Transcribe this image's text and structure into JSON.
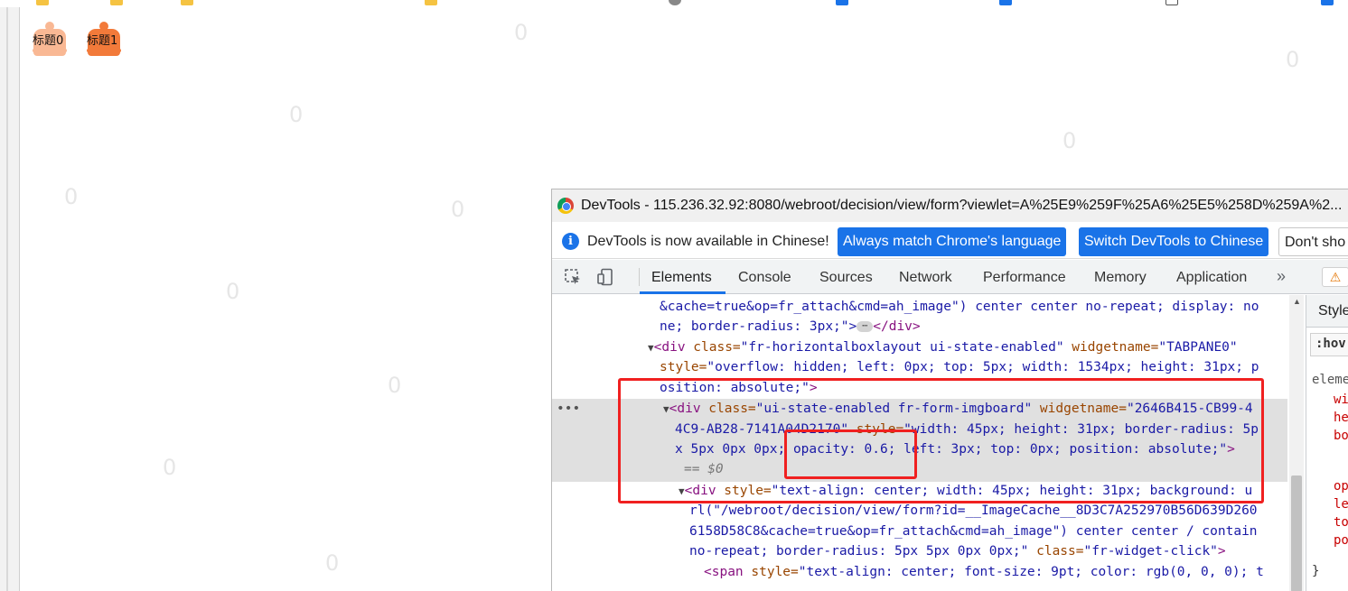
{
  "page": {
    "tabs": [
      {
        "label": "标题0",
        "color": "#f9b894"
      },
      {
        "label": "标题1",
        "color": "#f27a3a"
      }
    ],
    "watermark_char": "0"
  },
  "devtools": {
    "title": "DevTools - 115.236.32.92:8080/webroot/decision/view/form?viewlet=A%25E9%259F%25A6%25E5%258D%259A%2...",
    "info_message": "DevTools is now available in Chinese!",
    "buttons": {
      "match": "Always match Chrome's language",
      "switch": "Switch DevTools to Chinese",
      "dont_show": "Don't sho"
    },
    "panels": [
      "Elements",
      "Console",
      "Sources",
      "Network",
      "Performance",
      "Memory",
      "Application"
    ],
    "active_panel": "Elements",
    "more_tabs": "»",
    "warning": "⚠",
    "dom": {
      "l1": "&cache=true&op=fr_attach&cmd=ah_image\") center center no-repeat; display: no",
      "l2_text": "ne; border-radius: 3px;\">",
      "l2_close": "</div>",
      "ellipsis": "⋯",
      "l3_tag": "<div",
      "l3_attr": " class=",
      "l3_val": "\"fr-horizontalboxlayout ui-state-enabled\"",
      "l3_attr2": " widgetname=",
      "l3_val2": "\"TABPANE0\"",
      "l4_attr": "style=",
      "l4_val": "\"overflow: hidden; left: 0px; top: 5px; width: 1534px; height: 31px; p",
      "l5_val": "osition: absolute;\"",
      "l5_end": ">",
      "row_dots": "•••",
      "l6_tag": "<div",
      "l6_attr": " class=",
      "l6_val": "\"ui-state-enabled fr-form-imgboard\"",
      "l6_attr2": " widgetname=",
      "l6_val2": "\"2646B415-CB99-4",
      "l7_val": "4C9-AB28-7141A04D2170\"",
      "l7_attr": " style=",
      "l7_val2": "\"width: 45px; height: 31px; border-radius: 5p",
      "l8_val": "x 5px 0px 0px;",
      "l8_val_opacity": " opacity: 0.6;",
      "l8_val_rest": " left: 3px; top: 0px; position: absolute;\"",
      "l8_end": ">",
      "l9": "== $0",
      "l10_tag": "<div",
      "l10_attr": " style=",
      "l10_val": "\"text-align: center; width: 45px; height: 31px; background: u",
      "l11_val": "rl(\"/webroot/decision/view/form?id=__ImageCache__8D3C7A252970B56D639D260",
      "l12_val": "6158D58C8&cache=true&op=fr_attach&cmd=ah_image\") center center / contain",
      "l13_val": "no-repeat; border-radius: 5px 5px 0px 0px;\"",
      "l13_attr": " class=",
      "l13_val2": "\"fr-widget-click\"",
      "l13_end": ">",
      "l14_tag": "<span",
      "l14_attr": " style=",
      "l14_val": "\"text-align: center; font-size: 9pt; color: rgb(0, 0, 0); t"
    },
    "styles": {
      "header": "Style",
      "filter": ":hov",
      "element": "eleme",
      "props": [
        "wi",
        "he",
        "bo",
        "op",
        "le",
        "to",
        "po"
      ],
      "brace": "}"
    }
  }
}
